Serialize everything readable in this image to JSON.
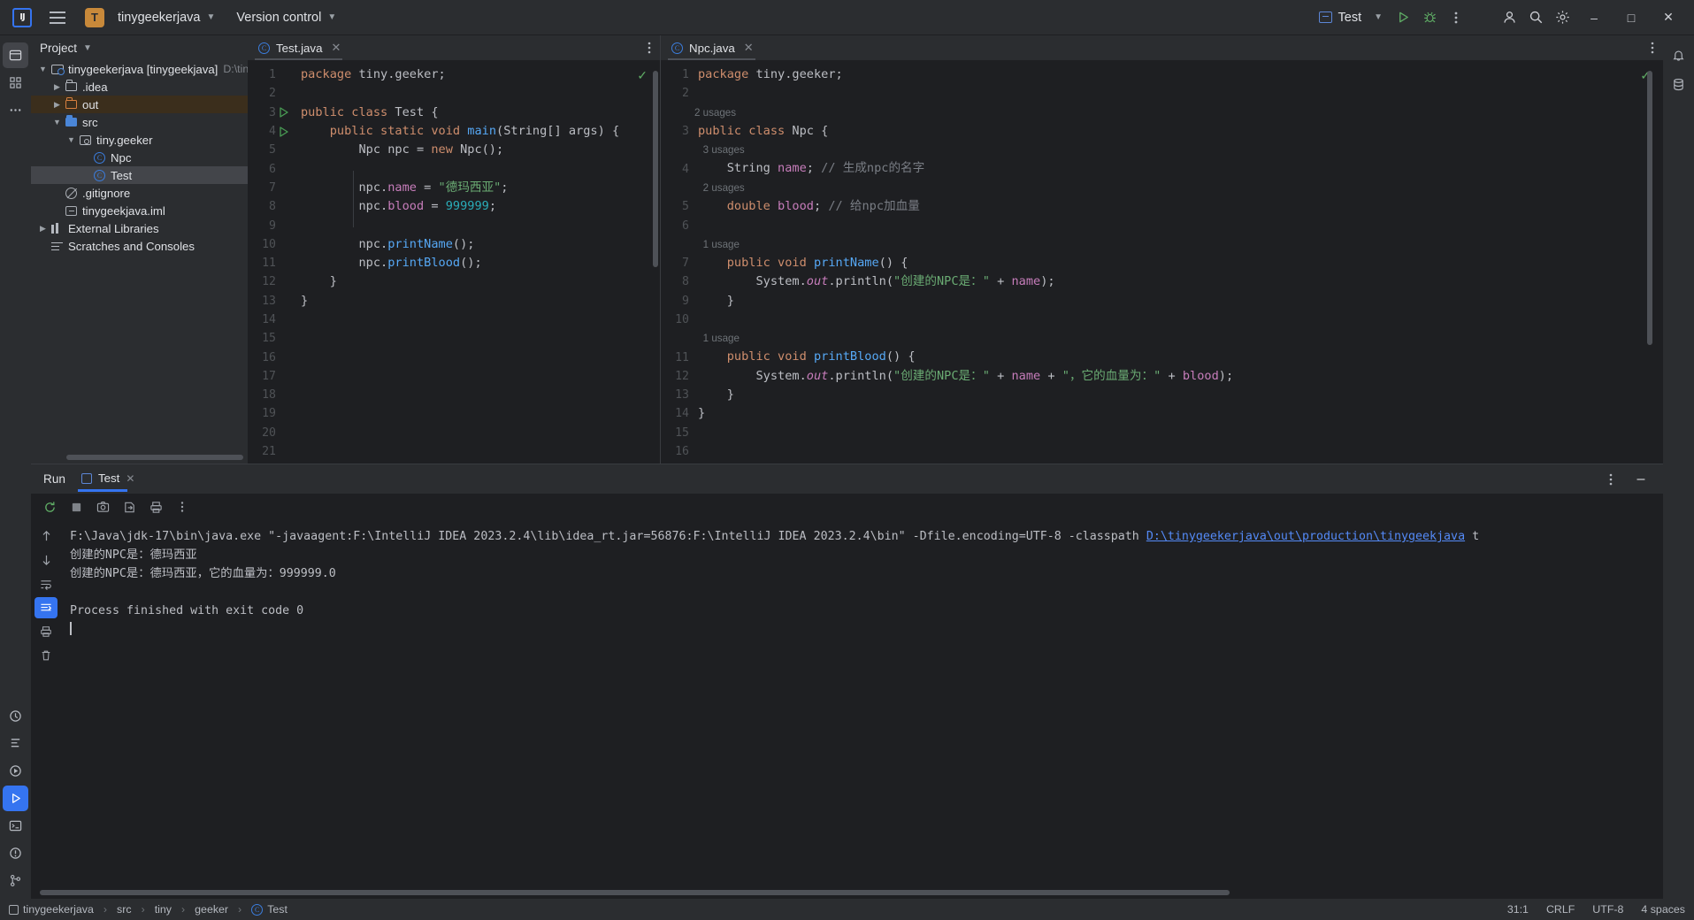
{
  "titlebar": {
    "logo": "IJ",
    "menu_icon": "hamburger-icon",
    "project_badge": "T",
    "project_name": "tinygeekerjava",
    "version_control": "Version control",
    "run_config": "Test",
    "run_icon": "run-icon",
    "debug_icon": "debug-icon",
    "more_icon": "more-vertical-icon",
    "account_icon": "account-icon",
    "search_icon": "search-icon",
    "settings_icon": "settings-icon",
    "minimize": "–",
    "maximize": "□",
    "close": "✕"
  },
  "project_panel": {
    "header": "Project",
    "items": [
      {
        "label": "tinygeekerjava [tinygeekjava]",
        "suffix": "D:\\tinyge",
        "icon": "module-icon",
        "arrow": "expanded",
        "indent": 0,
        "state": "normal"
      },
      {
        "label": ".idea",
        "suffix": "",
        "icon": "folder-icon",
        "arrow": "collapsed",
        "indent": 1,
        "state": "normal"
      },
      {
        "label": "out",
        "suffix": "",
        "icon": "folder-orange-icon",
        "arrow": "collapsed",
        "indent": 1,
        "state": "highlight"
      },
      {
        "label": "src",
        "suffix": "",
        "icon": "folder-blue-icon",
        "arrow": "expanded",
        "indent": 1,
        "state": "normal"
      },
      {
        "label": "tiny.geeker",
        "suffix": "",
        "icon": "package-icon",
        "arrow": "expanded",
        "indent": 2,
        "state": "normal"
      },
      {
        "label": "Npc",
        "suffix": "",
        "icon": "java-class-icon",
        "arrow": "none",
        "indent": 3,
        "state": "normal"
      },
      {
        "label": "Test",
        "suffix": "",
        "icon": "java-class-icon",
        "arrow": "none",
        "indent": 3,
        "state": "selected"
      },
      {
        "label": ".gitignore",
        "suffix": "",
        "icon": "gitignore-icon",
        "arrow": "none",
        "indent": 1,
        "state": "normal"
      },
      {
        "label": "tinygeekjava.iml",
        "suffix": "",
        "icon": "iml-file-icon",
        "arrow": "none",
        "indent": 1,
        "state": "normal"
      },
      {
        "label": "External Libraries",
        "suffix": "",
        "icon": "library-icon",
        "arrow": "collapsed",
        "indent": 0,
        "state": "normal"
      },
      {
        "label": "Scratches and Consoles",
        "suffix": "",
        "icon": "scratches-icon",
        "arrow": "none",
        "indent": 0,
        "state": "normal"
      }
    ]
  },
  "editor_left": {
    "tab": "Test.java",
    "tab_icon": "java-class-icon",
    "close_icon": "✕",
    "menu_icon": "more-vertical-icon",
    "inspection_status": "✓",
    "lines": [
      {
        "no": "1",
        "runmark": false,
        "html": "<span class=\"k\">package</span> <span class=\"t\">tiny.geeker;</span>"
      },
      {
        "no": "2",
        "runmark": false,
        "html": ""
      },
      {
        "no": "3",
        "runmark": true,
        "html": "<span class=\"k\">public class</span> <span class=\"t\">Test {</span>"
      },
      {
        "no": "4",
        "runmark": true,
        "html": "    <span class=\"k\">public static void</span> <span class=\"m\">main</span><span class=\"t\">(String[] args) {</span>"
      },
      {
        "no": "5",
        "runmark": false,
        "html": "        <span class=\"t\">Npc npc = </span><span class=\"k\">new</span><span class=\"t\"> Npc();</span>"
      },
      {
        "no": "6",
        "runmark": false,
        "html": ""
      },
      {
        "no": "7",
        "runmark": false,
        "html": "        <span class=\"t\">npc.</span><span class=\"f\">name</span><span class=\"t\"> = </span><span class=\"s\">\"德玛西亚\"</span><span class=\"t\">;</span>"
      },
      {
        "no": "8",
        "runmark": false,
        "html": "        <span class=\"t\">npc.</span><span class=\"f\">blood</span><span class=\"t\"> = </span><span class=\"n\">999999</span><span class=\"t\">;</span>"
      },
      {
        "no": "9",
        "runmark": false,
        "html": ""
      },
      {
        "no": "10",
        "runmark": false,
        "html": "        <span class=\"t\">npc.</span><span class=\"m\">printName</span><span class=\"t\">();</span>"
      },
      {
        "no": "11",
        "runmark": false,
        "html": "        <span class=\"t\">npc.</span><span class=\"m\">printBlood</span><span class=\"t\">();</span>"
      },
      {
        "no": "12",
        "runmark": false,
        "html": "    <span class=\"t\">}</span>"
      },
      {
        "no": "13",
        "runmark": false,
        "html": "<span class=\"t\">}</span>"
      },
      {
        "no": "14",
        "runmark": false,
        "html": ""
      },
      {
        "no": "15",
        "runmark": false,
        "html": ""
      },
      {
        "no": "16",
        "runmark": false,
        "html": ""
      },
      {
        "no": "17",
        "runmark": false,
        "html": ""
      },
      {
        "no": "18",
        "runmark": false,
        "html": ""
      },
      {
        "no": "19",
        "runmark": false,
        "html": ""
      },
      {
        "no": "20",
        "runmark": false,
        "html": ""
      },
      {
        "no": "21",
        "runmark": false,
        "html": ""
      }
    ]
  },
  "editor_right": {
    "tab": "Npc.java",
    "tab_icon": "java-class-icon",
    "close_icon": "✕",
    "menu_icon": "more-vertical-icon",
    "inspection_status": "✓",
    "lines": [
      {
        "no": "1",
        "hint": "",
        "html": "<span class=\"k\">package</span> <span class=\"t\">tiny.geeker;</span>"
      },
      {
        "no": "2",
        "hint": "",
        "html": ""
      },
      {
        "no": "3",
        "hint": "2 usages",
        "html": "<span class=\"k\">public class</span> <span class=\"t\">Npc {</span>"
      },
      {
        "no": "4",
        "hint": "   3 usages",
        "html": "    <span class=\"t\">String </span><span class=\"f\">name</span><span class=\"t\">; </span><span class=\"c\">// 生成npc的名字</span>"
      },
      {
        "no": "5",
        "hint": "   2 usages",
        "html": "    <span class=\"k\">double</span> <span class=\"f\">blood</span><span class=\"t\">; </span><span class=\"c\">// 给npc加血量</span>"
      },
      {
        "no": "6",
        "hint": "",
        "html": ""
      },
      {
        "no": "7",
        "hint": "   1 usage",
        "html": "    <span class=\"k\">public void</span> <span class=\"m\">printName</span><span class=\"t\">() {</span>"
      },
      {
        "no": "8",
        "hint": "",
        "html": "        <span class=\"t\">System.</span><span class=\"st\">out</span><span class=\"t\">.println(</span><span class=\"s\">\"创建的NPC是：\"</span><span class=\"t\"> + </span><span class=\"f\">name</span><span class=\"t\">);</span>"
      },
      {
        "no": "9",
        "hint": "",
        "html": "    <span class=\"t\">}</span>"
      },
      {
        "no": "10",
        "hint": "",
        "html": ""
      },
      {
        "no": "11",
        "hint": "   1 usage",
        "html": "    <span class=\"k\">public void</span> <span class=\"m\">printBlood</span><span class=\"t\">() {</span>"
      },
      {
        "no": "12",
        "hint": "",
        "html": "        <span class=\"t\">System.</span><span class=\"st\">out</span><span class=\"t\">.println(</span><span class=\"s\">\"创建的NPC是：\"</span><span class=\"t\"> + </span><span class=\"f\">name</span><span class=\"t\"> + </span><span class=\"s\">\"，它的血量为：\"</span><span class=\"t\"> + </span><span class=\"f\">blood</span><span class=\"t\">);</span>"
      },
      {
        "no": "13",
        "hint": "",
        "html": "    <span class=\"t\">}</span>"
      },
      {
        "no": "14",
        "hint": "",
        "html": "<span class=\"t\">}</span>"
      },
      {
        "no": "15",
        "hint": "",
        "html": ""
      },
      {
        "no": "16",
        "hint": "",
        "html": ""
      }
    ]
  },
  "run_panel": {
    "title": "Run",
    "tab": "Test",
    "tab_icon": "run-config-icon",
    "close_icon": "✕",
    "options_icon": "more-vertical-icon",
    "minimize_icon": "–",
    "toolbar_icons": [
      "rerun-icon",
      "stop-icon",
      "camera-icon",
      "export-icon",
      "print-icon",
      "more-vertical-icon"
    ],
    "side_icons": [
      "scroll-up-icon",
      "scroll-down-icon",
      "soft-wrap-icon",
      "scroll-to-end-icon",
      "print-icon",
      "trash-icon"
    ],
    "command_prefix": "F:\\Java\\jdk-17\\bin\\java.exe \"-javaagent:F:\\IntelliJ IDEA 2023.2.4\\lib\\idea_rt.jar=56876:F:\\IntelliJ IDEA 2023.2.4\\bin\" -Dfile.encoding=UTF-8 -classpath ",
    "command_link": "D:\\tinygeekerjava\\out\\production\\tinygeekjava",
    "command_suffix": " t",
    "output_lines": [
      "创建的NPC是：德玛西亚",
      "创建的NPC是：德玛西亚，它的血量为：999999.0",
      "",
      "Process finished with exit code 0"
    ]
  },
  "left_rail": {
    "top_icons": [
      "project-icon",
      "commit-icon",
      "more-icon"
    ],
    "bottom_icons": [
      "structure-icon",
      "terminal-icon",
      "problems-icon",
      "git-icon"
    ]
  },
  "right_rail": {
    "icons": [
      "notifications-icon",
      "database-icon"
    ]
  },
  "status_bar": {
    "breadcrumb": [
      "tinygeekerjava",
      "src",
      "tiny",
      "geeker",
      "Test"
    ],
    "breadcrumb_sep": "›",
    "caret_position": "31:1",
    "line_separator": "CRLF",
    "encoding": "UTF-8",
    "indent": "4 spaces"
  }
}
